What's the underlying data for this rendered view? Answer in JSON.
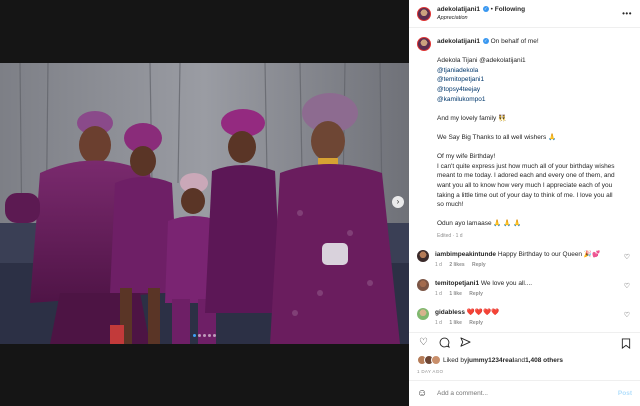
{
  "post": {
    "username": "adekolatijani1",
    "following_label": "Following",
    "subtitle": "Appreciation",
    "more": "•••"
  },
  "caption": {
    "author": "adekolatijani1",
    "lines": [
      "On behalf of me!",
      "",
      "Adekola Tijani @adekolatijani1",
      "@tjaniadekola",
      "@temitopetjani1",
      "@topsy4teejay",
      "@kamilukompo1",
      "",
      "And my lovely family 👯",
      "",
      "We Say Big Thanks to all well wishers 🙏",
      "",
      "Of my wife Birthday!",
      "I can't quite express just how much all of your birthday wishes",
      "meant to me today. I adored each and every one of them, and",
      "want you all to know how very much I appreciate each of you",
      "taking a little time out of your day to think of me. I love you all",
      "so much!",
      "",
      "Odun ayo lamaase 🙏 🙏 🙏"
    ],
    "edited": "Edited · 1 d"
  },
  "comments": [
    {
      "user": "iambimpeakintunde",
      "text": "Happy Birthday to our Queen 🎉💕",
      "time": "1 d",
      "likes": "2 likes",
      "reply": "Reply"
    },
    {
      "user": "temitopetjani1",
      "text": "We love you all....",
      "time": "1 d",
      "likes": "1 like",
      "reply": "Reply"
    },
    {
      "user": "gidabless",
      "text": "❤️❤️❤️❤️",
      "time": "1 d",
      "likes": "1 like",
      "reply": "Reply"
    }
  ],
  "likes": {
    "prefix": "Liked by ",
    "user": "jummy1234real",
    "middle": " and ",
    "others": "1,408 others"
  },
  "time_ago": "1 DAY AGO",
  "add_comment": {
    "placeholder": "Add a comment...",
    "post_label": "Post"
  },
  "carousel": {
    "slides": 5,
    "active": 0
  },
  "icons": {
    "like": "heart-icon",
    "comment": "comment-icon",
    "share": "share-icon",
    "save": "bookmark-icon",
    "emoji": "emoji-icon",
    "next": "chevron-right-icon"
  },
  "colors": {
    "accent": "#3897f0",
    "outfit": "#6a1d5e",
    "background": "#151515"
  }
}
